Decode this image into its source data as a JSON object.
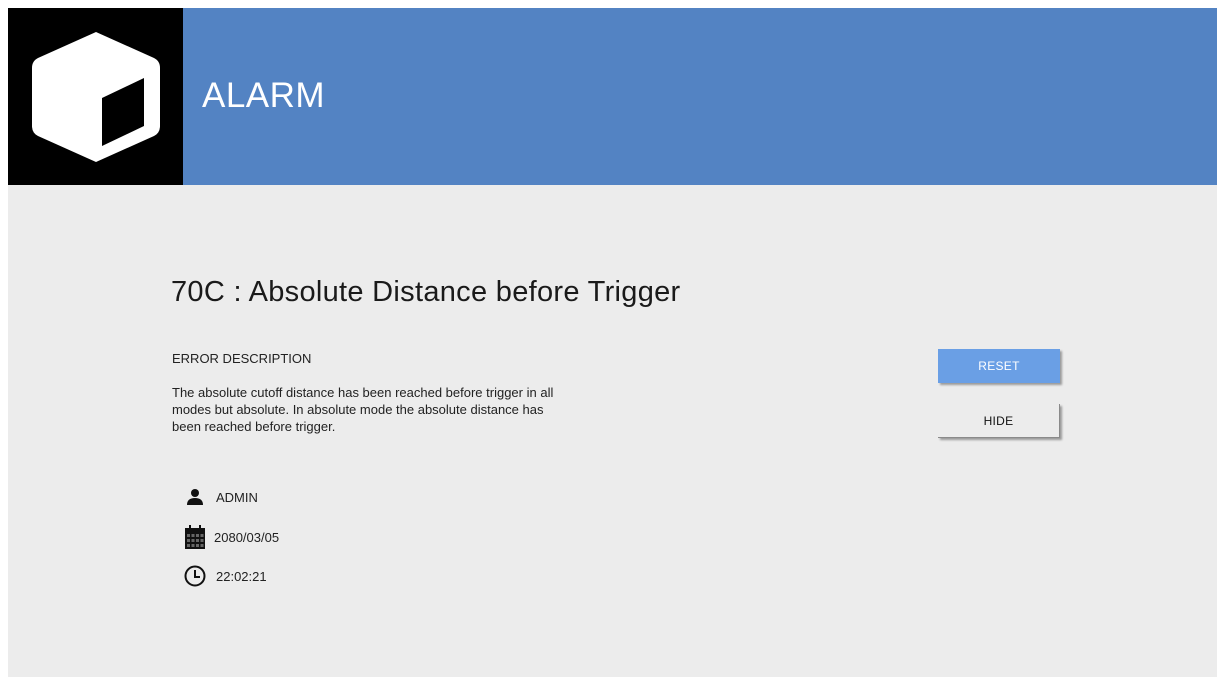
{
  "header": {
    "title": "ALARM",
    "logo_icon": "cube-icon",
    "color": "#5383c3"
  },
  "alarm": {
    "title": "70C : Absolute Distance before Trigger",
    "description_heading": "ERROR DESCRIPTION",
    "description": "The absolute cutoff distance has been reached before trigger in all modes but absolute. In absolute mode the absolute distance has been reached before trigger."
  },
  "info": {
    "user": "ADMIN",
    "user_icon": "user-icon",
    "date": "2080/03/05",
    "date_icon": "calendar-icon",
    "time": "22:02:21",
    "time_icon": "clock-icon"
  },
  "actions": {
    "reset_label": "RESET",
    "reset_color": "#6a9fe5",
    "hide_label": "HIDE"
  }
}
